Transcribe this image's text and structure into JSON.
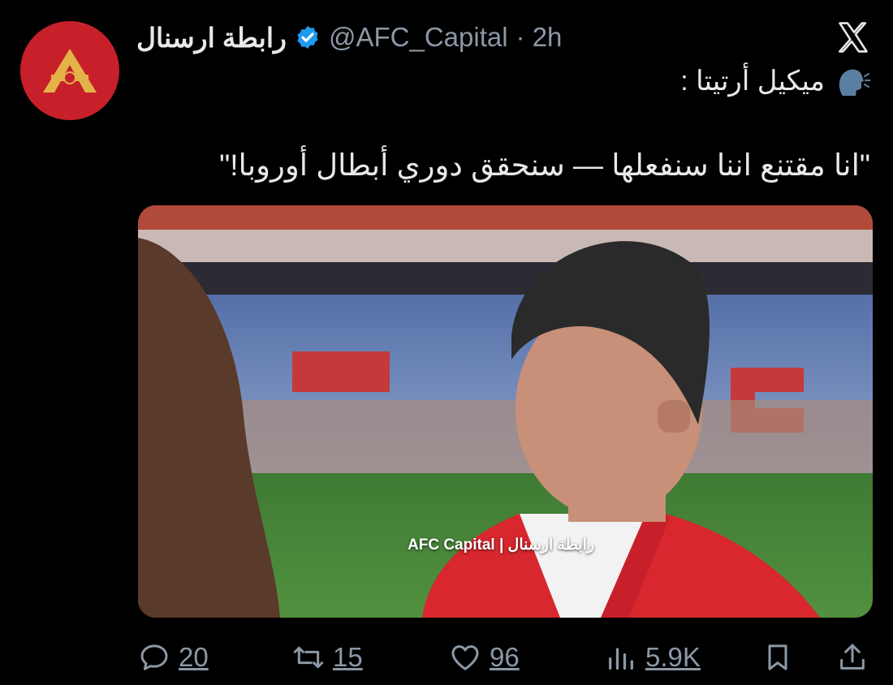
{
  "tweet": {
    "display_name": "رابطة ارسنال",
    "handle": "@AFC_Capital",
    "time": "· 2h",
    "line1": "ميكيل أرتيتا :",
    "line2": "\"انا مقتنع اننا سنفعلها — سنحقق دوري أبطال أوروبا!\""
  },
  "media": {
    "watermark": "AFC Capital | رابطة ارسنال"
  },
  "actions": {
    "replies": "20",
    "reposts": "15",
    "likes": "96",
    "views": "5.9K"
  },
  "colors": {
    "avatar_bg": "#c8202a",
    "verified": "#1d9bf0",
    "muted": "#8b98a5"
  }
}
